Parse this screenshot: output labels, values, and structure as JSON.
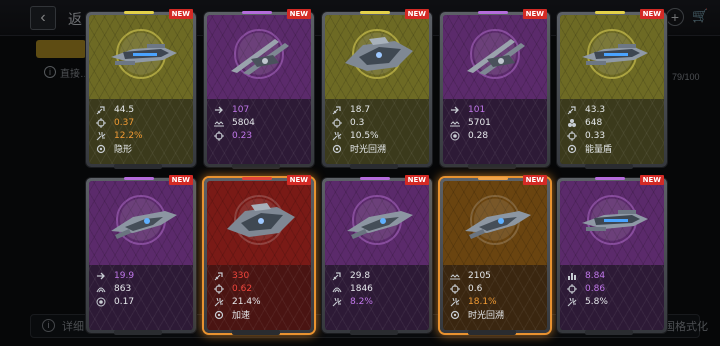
{
  "background": {
    "back_label": "返",
    "cart_count": "79/100",
    "notice_text": "直接…",
    "detail_label": "详细",
    "format_label": "国格式化"
  },
  "cards": [
    {
      "rarity": "yellow",
      "selected": false,
      "ship": "gunship",
      "new_label": "NEW",
      "stats": [
        {
          "icon": "attack-icon",
          "value": "44.5",
          "tone": "white"
        },
        {
          "icon": "crosshair-icon",
          "value": "0.37",
          "tone": "orange"
        },
        {
          "icon": "crit-icon",
          "value": "12.2%",
          "tone": "orange"
        },
        {
          "icon": "skill-icon",
          "value": "隐形",
          "tone": "white"
        }
      ]
    },
    {
      "rarity": "purple",
      "selected": false,
      "ship": "twin-cannon",
      "new_label": "NEW",
      "stats": [
        {
          "icon": "speed-icon",
          "value": "107",
          "tone": "purple"
        },
        {
          "icon": "range-icon",
          "value": "5804",
          "tone": "white"
        },
        {
          "icon": "crosshair-icon",
          "value": "0.23",
          "tone": "purple"
        }
      ]
    },
    {
      "rarity": "yellow",
      "selected": false,
      "ship": "heavy-frigate",
      "new_label": "NEW",
      "stats": [
        {
          "icon": "attack-icon",
          "value": "18.7",
          "tone": "white"
        },
        {
          "icon": "crosshair-icon",
          "value": "0.3",
          "tone": "white"
        },
        {
          "icon": "crit-icon",
          "value": "10.5%",
          "tone": "white"
        },
        {
          "icon": "skill-icon",
          "value": "时光回溯",
          "tone": "white"
        }
      ]
    },
    {
      "rarity": "purple",
      "selected": false,
      "ship": "twin-cannon",
      "new_label": "NEW",
      "stats": [
        {
          "icon": "speed-icon",
          "value": "101",
          "tone": "purple"
        },
        {
          "icon": "range-icon",
          "value": "5701",
          "tone": "white"
        },
        {
          "icon": "target-icon",
          "value": "0.28",
          "tone": "white"
        }
      ]
    },
    {
      "rarity": "yellow",
      "selected": false,
      "ship": "gunship",
      "new_label": "NEW",
      "stats": [
        {
          "icon": "attack-icon",
          "value": "43.3",
          "tone": "white"
        },
        {
          "icon": "shield-icon",
          "value": "648",
          "tone": "white"
        },
        {
          "icon": "crosshair-icon",
          "value": "0.33",
          "tone": "white"
        },
        {
          "icon": "skill-icon",
          "value": "能量盾",
          "tone": "white"
        }
      ]
    },
    {
      "rarity": "purple",
      "selected": false,
      "ship": "interceptor",
      "new_label": "NEW",
      "stats": [
        {
          "icon": "speed-icon",
          "value": "19.9",
          "tone": "purple"
        },
        {
          "icon": "armor-icon",
          "value": "863",
          "tone": "white"
        },
        {
          "icon": "target-icon",
          "value": "0.17",
          "tone": "white"
        }
      ]
    },
    {
      "rarity": "red",
      "selected": true,
      "ship": "heavy-frigate",
      "new_label": "NEW",
      "stats": [
        {
          "icon": "attack-icon",
          "value": "330",
          "tone": "red"
        },
        {
          "icon": "crosshair-icon",
          "value": "0.62",
          "tone": "red"
        },
        {
          "icon": "crit-icon",
          "value": "21.4%",
          "tone": "white"
        },
        {
          "icon": "skill-icon",
          "value": "加速",
          "tone": "white"
        }
      ]
    },
    {
      "rarity": "purple",
      "selected": false,
      "ship": "interceptor",
      "new_label": "NEW",
      "stats": [
        {
          "icon": "attack-icon",
          "value": "29.8",
          "tone": "white"
        },
        {
          "icon": "armor-icon",
          "value": "1846",
          "tone": "white"
        },
        {
          "icon": "crit-icon",
          "value": "8.2%",
          "tone": "purple"
        }
      ]
    },
    {
      "rarity": "orange",
      "selected": true,
      "ship": "interceptor",
      "new_label": "NEW",
      "stats": [
        {
          "icon": "range-icon",
          "value": "2105",
          "tone": "white"
        },
        {
          "icon": "crosshair-icon",
          "value": "0.6",
          "tone": "white"
        },
        {
          "icon": "crit-icon",
          "value": "18.1%",
          "tone": "orange"
        },
        {
          "icon": "skill-icon",
          "value": "时光回溯",
          "tone": "white"
        }
      ]
    },
    {
      "rarity": "purple",
      "selected": false,
      "ship": "gunship",
      "new_label": "NEW",
      "stats": [
        {
          "icon": "bars-icon",
          "value": "8.84",
          "tone": "purple"
        },
        {
          "icon": "crosshair-icon",
          "value": "0.86",
          "tone": "purple"
        },
        {
          "icon": "crit-icon",
          "value": "5.8%",
          "tone": "white"
        }
      ]
    }
  ]
}
